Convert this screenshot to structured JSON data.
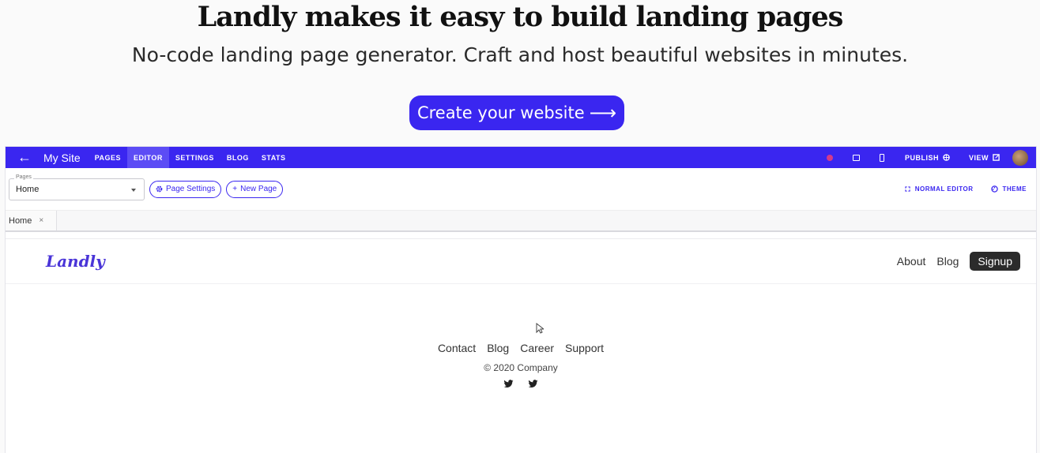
{
  "hero": {
    "title": "Landly makes it easy to build landing pages",
    "subtitle": "No-code landing page generator. Craft and host beautiful websites in minutes.",
    "cta_label": "Create your website",
    "cta_arrow": "⟶"
  },
  "editor": {
    "topbar": {
      "back_icon": "←",
      "site_name": "My Site",
      "tabs": [
        "PAGES",
        "EDITOR",
        "SETTINGS",
        "BLOG",
        "STATS"
      ],
      "active_tab": "EDITOR",
      "publish_label": "PUBLISH",
      "view_label": "VIEW"
    },
    "toolbar": {
      "pages_legend": "Pages",
      "pages_value": "Home",
      "page_settings_label": "Page Settings",
      "new_page_label": "New Page",
      "normal_editor_label": "NORMAL EDITOR",
      "theme_label": "THEME"
    },
    "open_tabs": [
      {
        "label": "Home",
        "close": "×"
      }
    ],
    "preview": {
      "logo": "Landly",
      "nav": {
        "about": "About",
        "blog": "Blog",
        "signup": "Signup"
      },
      "footer_links": [
        "Contact",
        "Blog",
        "Career",
        "Support"
      ],
      "copyright": "© 2020 Company"
    }
  },
  "colors": {
    "accent": "#3a26f0",
    "dark": "#2b2b2b"
  }
}
